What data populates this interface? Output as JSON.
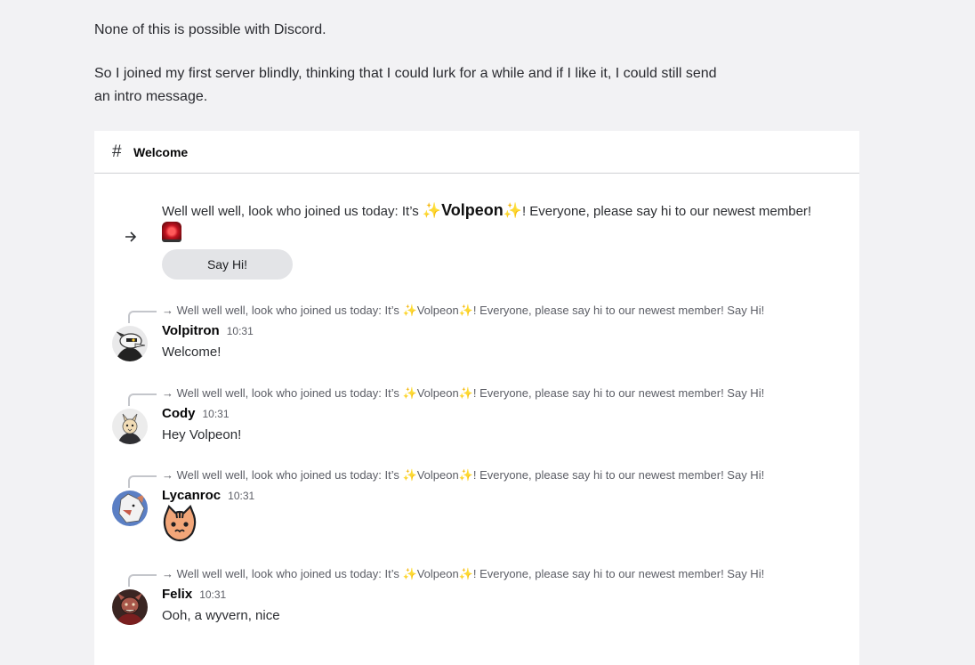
{
  "intro": {
    "p1": "None of this is possible with Discord.",
    "p2": "So I joined my first server blindly, thinking that I could lurk for a while and if I like it, I could still send an intro message."
  },
  "channel": {
    "hash": "#",
    "name": "Welcome"
  },
  "system_message": {
    "pre": "Well well well, look who joined us today: It’s",
    "highlight": "Volpeon",
    "post": "! Everyone, please say hi to our newest member!",
    "button": "Say Hi!"
  },
  "reply_preview": {
    "pre": "Well well well, look who joined us today: It’s",
    "name": "Volpeon",
    "post": "! Everyone, please say hi to our newest member! Say Hi!"
  },
  "messages": [
    {
      "author": "Volpitron",
      "time": "10:31",
      "content": "Welcome!"
    },
    {
      "author": "Cody",
      "time": "10:31",
      "content": "Hey Volpeon!"
    },
    {
      "author": "Lycanroc",
      "time": "10:31",
      "content": ""
    },
    {
      "author": "Felix",
      "time": "10:31",
      "content": "Ooh, a wyvern, nice"
    }
  ],
  "colors": {
    "sparkle": "#f4b400",
    "background": "#f2f2f4",
    "panel": "#ffffff"
  },
  "icons": {
    "system_arrow": "arrow-right-icon",
    "siren": "rotating-light-icon",
    "sparkle": "sparkles-icon"
  }
}
